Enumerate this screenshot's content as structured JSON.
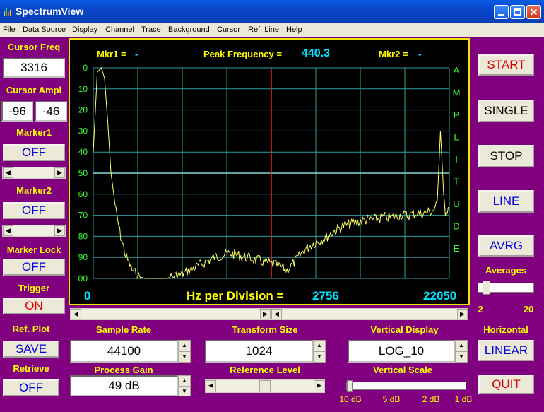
{
  "window": {
    "title": "SpectrumView"
  },
  "menu": [
    "File",
    "Data Source",
    "Display",
    "Channel",
    "Trace",
    "Background",
    "Cursor",
    "Ref. Line",
    "Help"
  ],
  "left": {
    "cursor_freq_label": "Cursor Freq",
    "cursor_freq_value": "3316",
    "cursor_ampl_label": "Cursor Ampl",
    "cursor_ampl_value1": "-96",
    "cursor_ampl_value2": "-46",
    "marker1_label": "Marker1",
    "marker1_value": "OFF",
    "marker2_label": "Marker2",
    "marker2_value": "OFF",
    "marker_lock_label": "Marker Lock",
    "marker_lock_value": "OFF",
    "trigger_label": "Trigger",
    "trigger_value": "ON",
    "ref_plot_label": "Ref. Plot",
    "save_label": "SAVE",
    "retrieve_label": "Retrieve",
    "retrieve_value": "OFF"
  },
  "scope": {
    "mkr1_label": "Mkr1 =",
    "mkr1_value": "-",
    "peak_label": "Peak Frequency =",
    "peak_value": "440.3",
    "mkr2_label": "Mkr2 =",
    "mkr2_value": "-",
    "y_ticks": [
      "0",
      "10",
      "20",
      "30",
      "40",
      "50",
      "60",
      "70",
      "80",
      "90",
      "100"
    ],
    "amplitude_letters": [
      "A",
      "M",
      "P",
      "L",
      "I",
      "T",
      "U",
      "D",
      "E"
    ],
    "x_start": "0",
    "x_end": "22050",
    "hz_per_div_label": "Hz per Division =",
    "hz_per_div_value": "2756",
    "colors": {
      "grid": "#2aa0a0",
      "trace": "#ffff66",
      "cursor": "#ff2020",
      "ref_line": "#7fd6d6",
      "text": "#ffff00",
      "value": "#00e5ff"
    }
  },
  "right": {
    "start_label": "START",
    "single_label": "SINGLE",
    "stop_label": "STOP",
    "line_label": "LINE",
    "avrg_label": "AVRG",
    "averages_label": "Averages",
    "averages_min": "2",
    "averages_max": "20",
    "averages_value": 2,
    "horizontal_label": "Horizontal",
    "linear_label": "LINEAR",
    "quit_label": "QUIT"
  },
  "bottom": {
    "sample_rate_label": "Sample Rate",
    "sample_rate_value": "44100",
    "transform_size_label": "Transform Size",
    "transform_size_value": "1024",
    "vertical_display_label": "Vertical Display",
    "vertical_display_value": "LOG_10",
    "process_gain_label": "Process Gain",
    "process_gain_value": "49 dB",
    "reference_level_label": "Reference Level",
    "vertical_scale_label": "Vertical Scale",
    "vertical_scale_ticks": [
      "10 dB",
      "5 dB",
      "2 dB",
      "1 dB"
    ]
  },
  "chart_data": {
    "type": "line",
    "title": "",
    "ylim": [
      0,
      100
    ],
    "xlim": [
      0,
      22050
    ],
    "y_inverted": true,
    "cursor_x": 11025,
    "ref_line_y": 50,
    "x": [
      0,
      250,
      500,
      700,
      900,
      1100,
      1400,
      1700,
      2000,
      2400,
      2800,
      3200,
      3316,
      3600,
      4000,
      4500,
      5000,
      5500,
      6000,
      6500,
      7000,
      7500,
      8000,
      8500,
      9000,
      9500,
      10000,
      10500,
      11000,
      11500,
      12000,
      12500,
      13000,
      13500,
      14000,
      14500,
      15000,
      15500,
      16000,
      16500,
      17000,
      17500,
      18000,
      18500,
      19000,
      19500,
      20000,
      20500,
      21000,
      21300,
      21500,
      21700,
      21800,
      22050
    ],
    "values": [
      40,
      2,
      0,
      5,
      26,
      50,
      68,
      80,
      89,
      96,
      99,
      100,
      100,
      100,
      100,
      100,
      99,
      98,
      96,
      94,
      92,
      90,
      89,
      88,
      89,
      90,
      91,
      92,
      93,
      94,
      96,
      92,
      87,
      84,
      82,
      80,
      77,
      75,
      74,
      73,
      72,
      72,
      71,
      71,
      70,
      70,
      69,
      69,
      68,
      65,
      30,
      60,
      68,
      66
    ]
  }
}
